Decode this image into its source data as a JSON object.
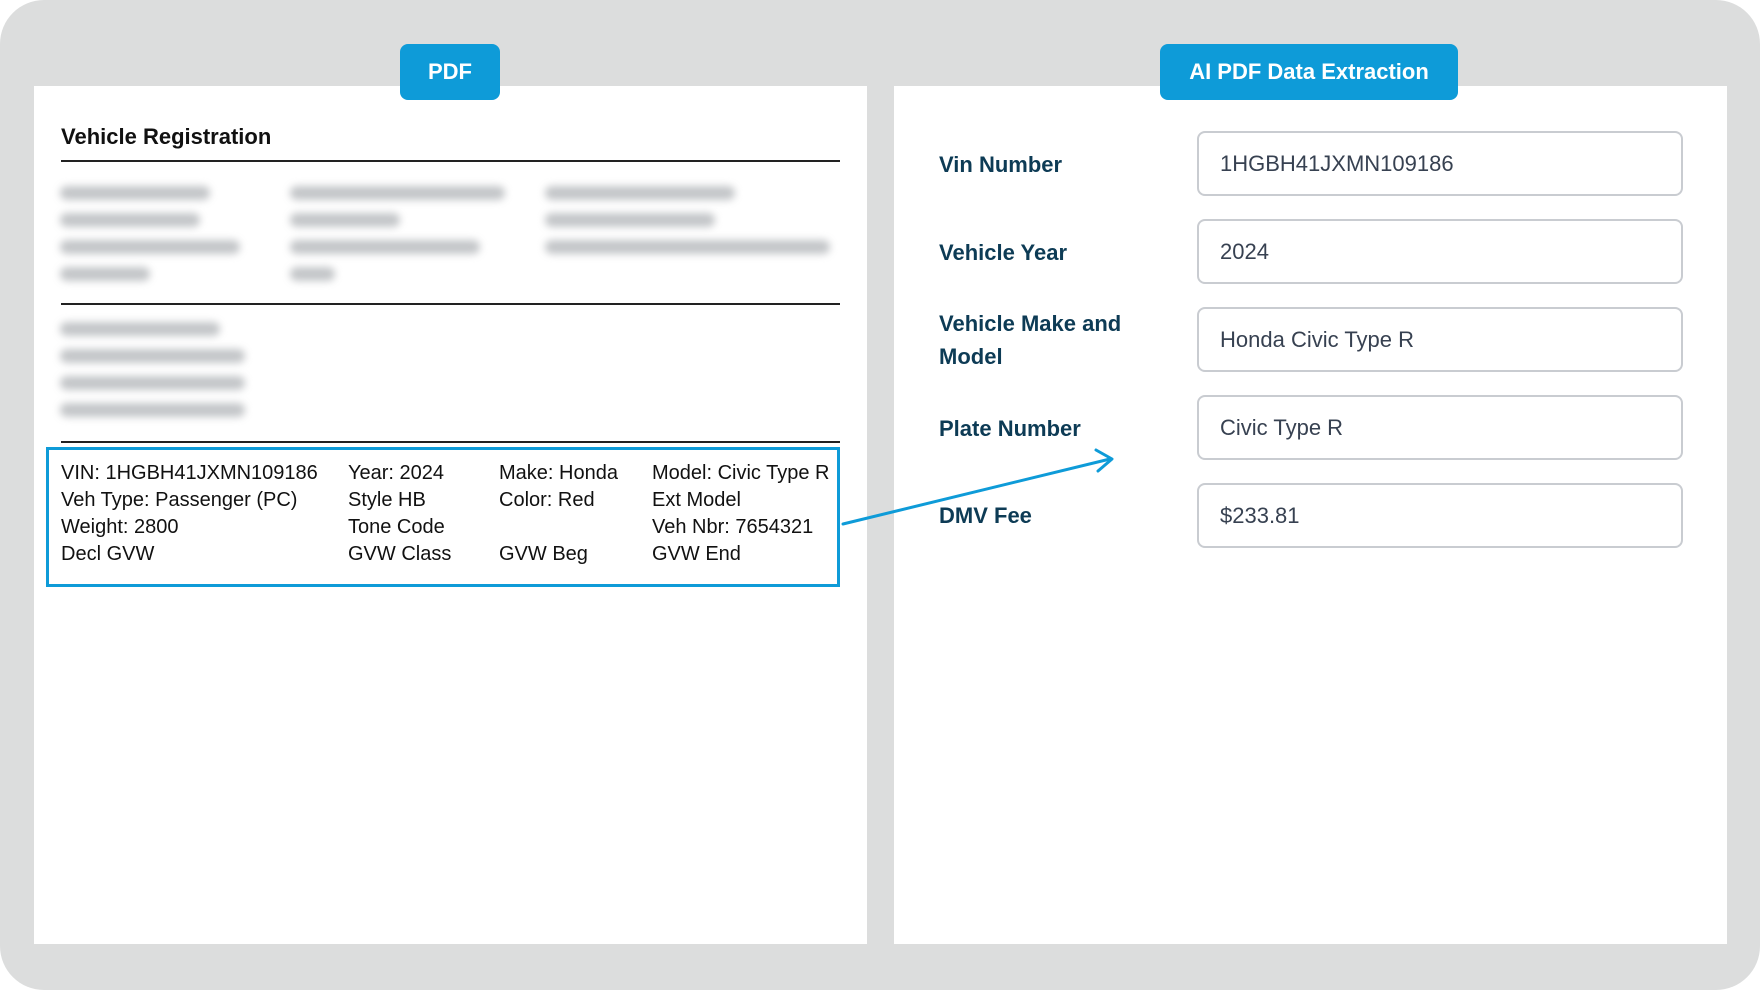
{
  "tabs": {
    "pdf": "PDF",
    "extraction": "AI PDF Data Extraction"
  },
  "document": {
    "title": "Vehicle Registration",
    "vehicle_rows": [
      [
        "VIN: 1HGBH41JXMN109186",
        "Year: 2024",
        "Make: Honda",
        "Model: Civic Type R"
      ],
      [
        "Veh Type: Passenger (PC)",
        "Style HB",
        "Color: Red",
        "Ext Model"
      ],
      [
        "Weight: 2800",
        "Tone Code",
        "",
        "Veh Nbr: 7654321"
      ],
      [
        "Decl GVW",
        "GVW Class",
        "GVW Beg",
        "GVW End"
      ]
    ]
  },
  "extraction": {
    "fields": [
      {
        "label": "Vin Number",
        "value": "1HGBH41JXMN109186"
      },
      {
        "label": "Vehicle Year",
        "value": "2024"
      },
      {
        "label": "Vehicle Make and Model",
        "value": "Honda Civic Type R"
      },
      {
        "label": "Plate Number",
        "value": "Civic Type R"
      },
      {
        "label": "DMV Fee",
        "value": "$233.81"
      }
    ]
  },
  "colors": {
    "accent": "#0e9bd8",
    "label": "#0d3b55",
    "frame": "#dcdddd"
  }
}
